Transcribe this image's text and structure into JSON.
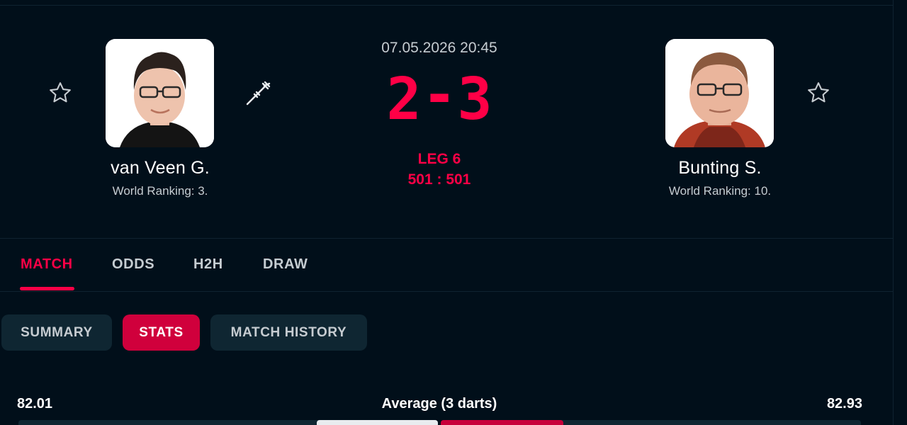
{
  "colors": {
    "background": "#010f1a",
    "accent": "#ff0046",
    "active_subtab": "#d0003c",
    "muted_text": "#c6ccd1",
    "subtab_bg": "#0f2632"
  },
  "match": {
    "datetime": "07.05.2026 20:45",
    "score_home": "2",
    "score_separator": "-",
    "score_away": "3",
    "leg_label": "LEG 6",
    "leg_score": "501 : 501"
  },
  "home_player": {
    "name": "van Veen G.",
    "ranking": "World Ranking: 3.",
    "favorite_icon": "star-outline-icon",
    "serving_icon": "dart-icon"
  },
  "away_player": {
    "name": "Bunting S.",
    "ranking": "World Ranking: 10.",
    "favorite_icon": "star-outline-icon"
  },
  "tabs": [
    {
      "label": "MATCH",
      "active": true
    },
    {
      "label": "ODDS",
      "active": false
    },
    {
      "label": "H2H",
      "active": false
    },
    {
      "label": "DRAW",
      "active": false
    }
  ],
  "subtabs": [
    {
      "label": "SUMMARY",
      "active": false
    },
    {
      "label": "STATS",
      "active": true
    },
    {
      "label": "MATCH HISTORY",
      "active": false
    }
  ],
  "stats": [
    {
      "label": "Average (3 darts)",
      "home": "82.01",
      "away": "82.93",
      "home_share": 0.497,
      "away_share": 0.503
    }
  ]
}
